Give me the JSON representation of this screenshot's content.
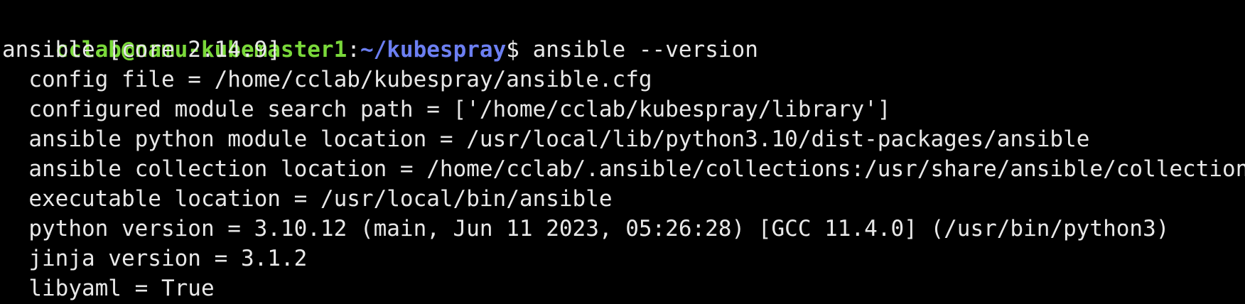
{
  "colors": {
    "background": "#000000",
    "user_host": "#7ad93a",
    "path": "#6c7ff2",
    "text": "#e8e8e8",
    "cut_text": "#d6b84a"
  },
  "prompt": {
    "user_host": "cclab@namu-kubemaster1",
    "separator": ":",
    "cwd": "~/kubespray",
    "symbol": "$ ",
    "command": "ansible --version"
  },
  "output": [
    "ansible [core 2.14.9]",
    "  config file = /home/cclab/kubespray/ansible.cfg",
    "  configured module search path = ['/home/cclab/kubespray/library']",
    "  ansible python module location = /usr/local/lib/python3.10/dist-packages/ansible",
    "  ansible collection location = /home/cclab/.ansible/collections:/usr/share/ansible/collections",
    "  executable location = /usr/local/bin/ansible",
    "  python version = 3.10.12 (main, Jun 11 2023, 05:26:28) [GCC 11.4.0] (/usr/bin/python3)",
    "  jinja version = 3.1.2",
    "  libyaml = True"
  ]
}
